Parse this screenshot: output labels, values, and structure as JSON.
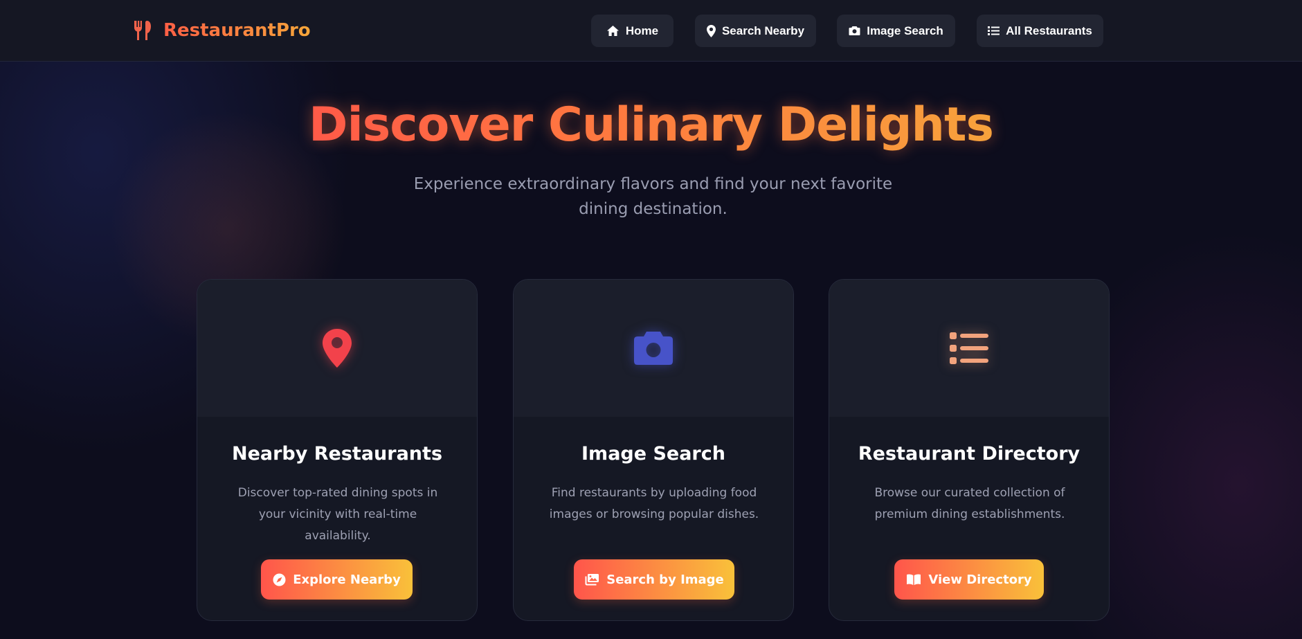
{
  "brand": {
    "name": "RestaurantPro",
    "icon": "utensils-icon"
  },
  "nav": {
    "items": [
      {
        "label": "Home",
        "icon": "home-icon"
      },
      {
        "label": "Search Nearby",
        "icon": "map-pin-icon"
      },
      {
        "label": "Image Search",
        "icon": "camera-icon"
      },
      {
        "label": "All Restaurants",
        "icon": "list-icon"
      }
    ]
  },
  "hero": {
    "title": "Discover Culinary Delights",
    "subtitle": "Experience extraordinary flavors and find your next favorite dining destination."
  },
  "cards": [
    {
      "icon": "map-pin-icon",
      "title": "Nearby Restaurants",
      "description": "Discover top-rated dining spots in your vicinity with real-time availability.",
      "button": {
        "label": "Explore Nearby",
        "icon": "compass-icon"
      }
    },
    {
      "icon": "camera-icon",
      "title": "Image Search",
      "description": "Find restaurants by uploading food images or browsing popular dishes.",
      "button": {
        "label": "Search by Image",
        "icon": "images-icon"
      }
    },
    {
      "icon": "list-icon",
      "title": "Restaurant Directory",
      "description": "Browse our curated collection of premium dining establishments.",
      "button": {
        "label": "View Directory",
        "icon": "book-icon"
      }
    }
  ],
  "colors": {
    "accent_start": "#ff5a48",
    "accent_end": "#f7a23c",
    "button_gradient_end": "#f9c13a",
    "pin_red": "#f2424b",
    "camera_blue": "#4753c9",
    "list_peach": "#f2a37d",
    "background": "#0d0d1d",
    "card_bg": "#151824"
  }
}
